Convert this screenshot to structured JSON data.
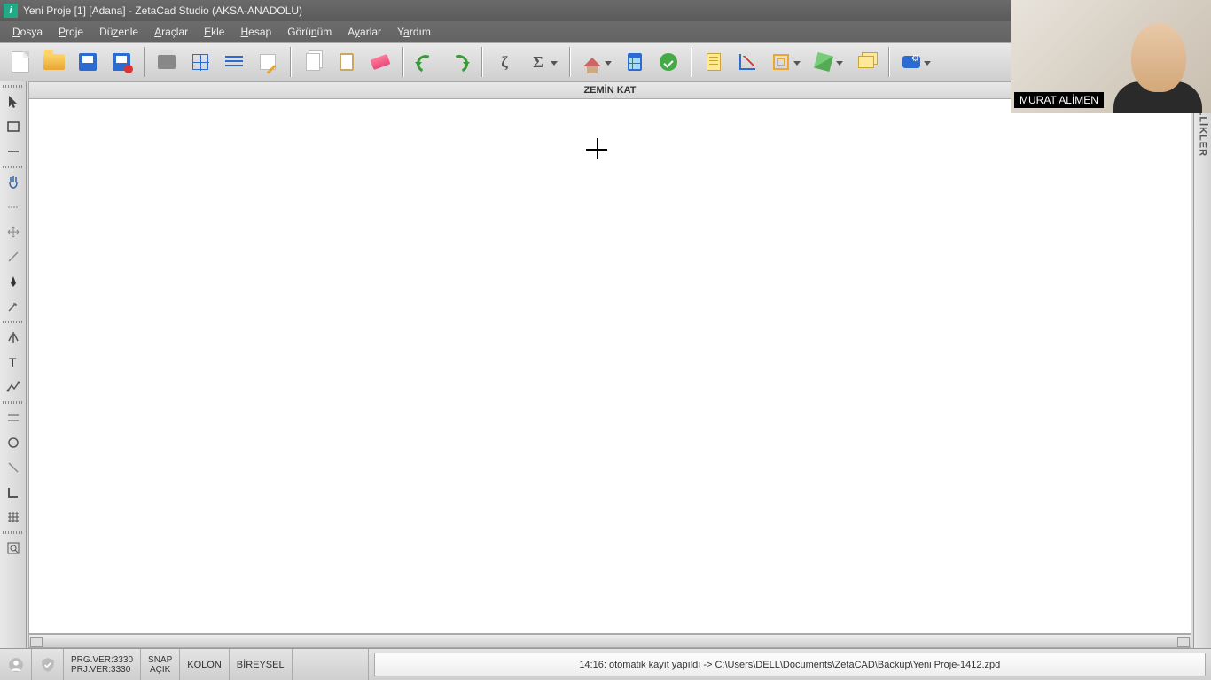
{
  "title": "Yeni Proje  [1]   [Adana]   - ZetaCad Studio (AKSA-ANADOLU)",
  "menu": [
    "Dosya",
    "Proje",
    "Düzenle",
    "Araçlar",
    "Ekle",
    "Hesap",
    "Görünüm",
    "Ayarlar",
    "Yardım"
  ],
  "menu_ul": [
    0,
    0,
    2,
    0,
    0,
    0,
    4,
    1,
    1
  ],
  "canvas_title": "ZEMİN KAT",
  "right_panel": "ÖZELLİKLER",
  "webcam_name": "MURAT ALİMEN",
  "status": {
    "prg": "PRG.VER:3330",
    "prj": "PRJ.VER:3330",
    "snap1": "SNAP",
    "snap2": "AÇIK",
    "kolon": "KOLON",
    "bireysel": "BİREYSEL",
    "msg": "14:16: otomatik kayıt yapıldı -> C:\\Users\\DELL\\Documents\\ZetaCAD\\Backup\\Yeni Proje-1412.zpd"
  }
}
